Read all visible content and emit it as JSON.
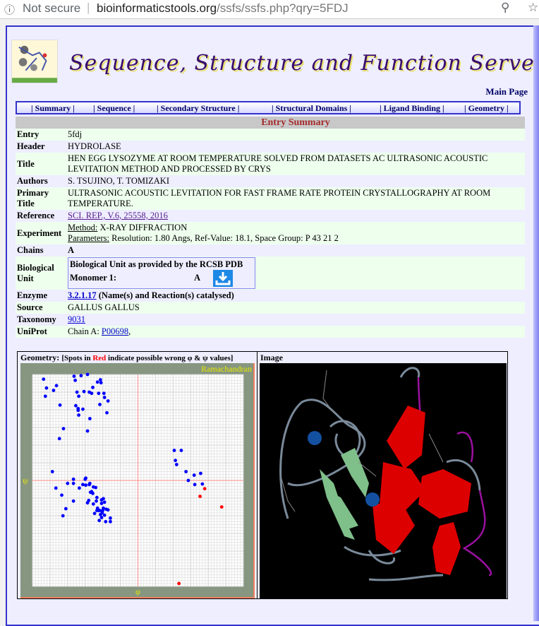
{
  "browser": {
    "security": "Not secure",
    "url_domain": "bioinformaticstools.org",
    "url_path": "/ssfs/ssfs.php?qry=5FDJ",
    "icons": [
      "info-icon",
      "zoom-icon",
      "star-icon"
    ]
  },
  "site": {
    "title": "Sequence, Structure and Function Server",
    "main_page": "Main Page"
  },
  "nav": [
    "| Summary |",
    "| Sequence |",
    "| Secondary Structure |",
    "| Structural Domains |",
    "| Ligand Binding |",
    "| Geometry |"
  ],
  "summary": {
    "heading": "Entry Summary",
    "entry": {
      "label": "Entry",
      "value": "5fdj"
    },
    "header": {
      "label": "Header",
      "value": "HYDROLASE"
    },
    "title": {
      "label": "Title",
      "value": "HEN EGG LYSOZYME AT ROOM TEMPERATURE SOLVED FROM DATASETS AC ULTRASONIC ACOUSTIC LEVITATION METHOD AND PROCESSED BY CRYS"
    },
    "authors": {
      "label": "Authors",
      "value": "S. TSUJINO, T. TOMIZAKI"
    },
    "primary_title": {
      "label": "Primary Title",
      "value": "ULTRASONIC ACOUSTIC LEVITATION FOR FAST FRAME RATE PROTEIN CRYSTALLOGRAPHY AT ROOM TEMPERATURE."
    },
    "reference": {
      "label": "Reference",
      "value": "SCI. REP., V.6, 25558, 2016"
    },
    "experiment": {
      "label": "Experiment",
      "method_label": "Method:",
      "method": " X-RAY DIFFRACTION",
      "params_label": "Parameters:",
      "params": " Resolution: 1.80 Angs, Ref-Value: 18.1, Space Group: P 43 21 2"
    },
    "chains": {
      "label": "Chains",
      "value": "A"
    },
    "bio_unit": {
      "label": "Biological Unit",
      "box_title": "Biological Unit as provided by the RCSB PDB",
      "monomer_label": "Monomer 1:",
      "monomer_value": "A",
      "download_icon": "download-icon"
    },
    "enzyme": {
      "label": "Enzyme",
      "ec": "3.2.1.17",
      "desc": " (Name(s) and Reaction(s) catalysed)"
    },
    "source": {
      "label": "Source",
      "value": "GALLUS GALLUS"
    },
    "taxonomy": {
      "label": "Taxonomy",
      "value": "9031"
    },
    "uniprot": {
      "label": "UniProt",
      "prefix": "Chain A: ",
      "id": "P00698",
      "suffix": ","
    }
  },
  "geometry": {
    "label": "Geometry:",
    "note_pre": "[Spots in ",
    "note_red": "Red",
    "note_post": " indicate possible wrong φ & ψ values]"
  },
  "image": {
    "label": "Image"
  },
  "colors": {
    "normal": "#0000ff",
    "outlier": "#ff0000",
    "plot_bg": "#869680",
    "axis": "#ff8888",
    "label": "#e8e800"
  },
  "chart_data": {
    "type": "scatter",
    "title": "Ramachandran",
    "xlabel": "φ",
    "ylabel": "ψ",
    "xlim": [
      -180,
      180
    ],
    "ylim": [
      -180,
      180
    ],
    "grid": true,
    "series": [
      {
        "color": "#0000ff",
        "points": [
          [
            -161,
            172
          ],
          [
            -156,
            157
          ],
          [
            -158,
            143
          ],
          [
            -144,
            153
          ],
          [
            -139,
            161
          ],
          [
            -133,
            128
          ],
          [
            -127,
            88
          ],
          [
            -134,
            71
          ],
          [
            -109,
            177
          ],
          [
            -107,
            170
          ],
          [
            -97,
            178
          ],
          [
            -86,
            180
          ],
          [
            -104,
            150
          ],
          [
            -101,
            143
          ],
          [
            -92,
            151
          ],
          [
            -83,
            150
          ],
          [
            -79,
            148
          ],
          [
            -77,
            158
          ],
          [
            -69,
            167
          ],
          [
            -64,
            171
          ],
          [
            -63,
            166
          ],
          [
            -67,
            148
          ],
          [
            -58,
            148
          ],
          [
            -57,
            141
          ],
          [
            -51,
            135
          ],
          [
            -65,
            129
          ],
          [
            -53,
            115
          ],
          [
            -106,
            127
          ],
          [
            -102,
            122
          ],
          [
            -102,
            119
          ],
          [
            -94,
            121
          ],
          [
            -101,
            111
          ],
          [
            -82,
            105
          ],
          [
            -86,
            84
          ],
          [
            62,
            51
          ],
          [
            74,
            51
          ],
          [
            64,
            34
          ],
          [
            66,
            27
          ],
          [
            82,
            15
          ],
          [
            96,
            9
          ],
          [
            107,
            12
          ],
          [
            86,
            0
          ],
          [
            97,
            -7
          ],
          [
            110,
            -6
          ],
          [
            -146,
            15
          ],
          [
            -140,
            -13
          ],
          [
            -130,
            -25
          ],
          [
            -120,
            -5
          ],
          [
            -110,
            -5
          ],
          [
            -110,
            2
          ],
          [
            -100,
            -13
          ],
          [
            -94,
            -7
          ],
          [
            -89,
            -8
          ],
          [
            -90,
            2
          ],
          [
            -89,
            4
          ],
          [
            -82,
            -5
          ],
          [
            -83,
            -7
          ],
          [
            -76,
            -11
          ],
          [
            -72,
            -12
          ],
          [
            -81,
            -20
          ],
          [
            -77,
            -22
          ],
          [
            -79,
            -19
          ],
          [
            -110,
            -35
          ],
          [
            -86,
            -38
          ],
          [
            -84,
            -34
          ],
          [
            -76,
            -40
          ],
          [
            -71,
            -35
          ],
          [
            -70,
            -29
          ],
          [
            -123,
            -48
          ],
          [
            -128,
            -60
          ],
          [
            -74,
            -56
          ],
          [
            -66,
            -68
          ],
          [
            -55,
            -70
          ],
          [
            -47,
            -70
          ],
          [
            -47,
            -64
          ],
          [
            -59,
            -31
          ],
          [
            -62,
            -33
          ],
          [
            -57,
            -37
          ],
          [
            -62,
            -39
          ],
          [
            -69,
            -47
          ],
          [
            -65,
            -51
          ],
          [
            -59,
            -47
          ],
          [
            -54,
            -49
          ],
          [
            -51,
            -50
          ],
          [
            -61,
            -55
          ],
          [
            -57,
            -59
          ],
          [
            -62,
            -63
          ],
          [
            -67,
            -51
          ],
          [
            -70,
            -51
          ],
          [
            -60,
            -51
          ],
          [
            -64,
            -58
          ]
        ]
      },
      {
        "color": "#ff0000",
        "points": [
          [
            114,
            -14
          ],
          [
            106,
            -27
          ],
          [
            143,
            -45
          ],
          [
            70,
            -175
          ]
        ]
      }
    ]
  }
}
